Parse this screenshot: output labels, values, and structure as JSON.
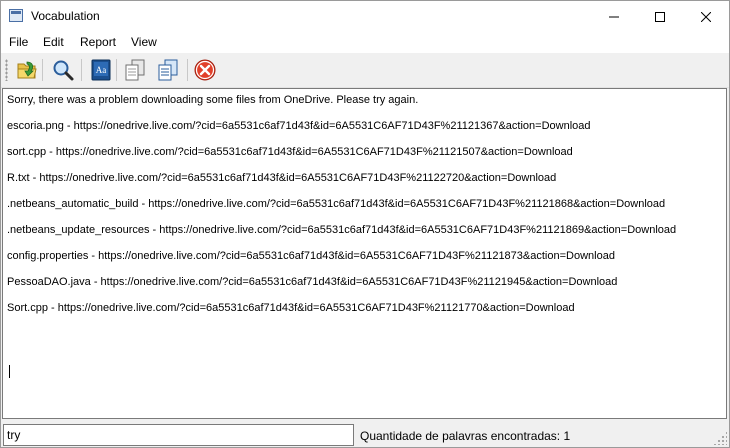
{
  "window": {
    "title": "Vocabulation"
  },
  "menu": {
    "items": [
      {
        "label": "File"
      },
      {
        "label": "Edit"
      },
      {
        "label": "Report"
      },
      {
        "label": "View"
      }
    ]
  },
  "toolbar": {
    "tools": [
      {
        "icon": "open-folder-icon"
      },
      {
        "icon": "search-icon"
      },
      {
        "icon": "dictionary-icon"
      },
      {
        "icon": "copy-icon"
      },
      {
        "icon": "paste-icon"
      },
      {
        "icon": "stop-icon"
      }
    ]
  },
  "content": {
    "lines": [
      "Sorry, there was a problem downloading some files from OneDrive. Please try again.",
      "escoria.png - https://onedrive.live.com/?cid=6a5531c6af71d43f&id=6A5531C6AF71D43F%21121367&action=Download",
      "sort.cpp - https://onedrive.live.com/?cid=6a5531c6af71d43f&id=6A5531C6AF71D43F%21121507&action=Download",
      "R.txt - https://onedrive.live.com/?cid=6a5531c6af71d43f&id=6A5531C6AF71D43F%21122720&action=Download",
      ".netbeans_automatic_build - https://onedrive.live.com/?cid=6a5531c6af71d43f&id=6A5531C6AF71D43F%21121868&action=Download",
      ".netbeans_update_resources - https://onedrive.live.com/?cid=6a5531c6af71d43f&id=6A5531C6AF71D43F%21121869&action=Download",
      "config.properties - https://onedrive.live.com/?cid=6a5531c6af71d43f&id=6A5531C6AF71D43F%21121873&action=Download",
      "PessoaDAO.java - https://onedrive.live.com/?cid=6a5531c6af71d43f&id=6A5531C6AF71D43F%21121945&action=Download",
      "Sort.cpp - https://onedrive.live.com/?cid=6a5531c6af71d43f&id=6A5531C6AF71D43F%21121770&action=Download"
    ]
  },
  "statusbar": {
    "search_value": "try",
    "status_text": "Quantidade de palavras encontradas: 1"
  }
}
